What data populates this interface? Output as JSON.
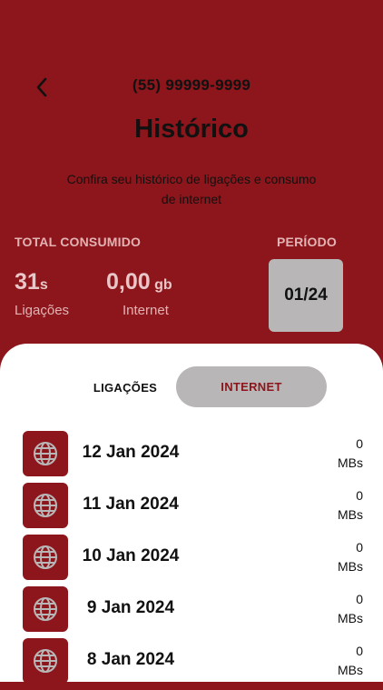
{
  "colors": {
    "primary": "#8c161b",
    "panel": "#ffffff",
    "chip": "#b8b6b6"
  },
  "header": {
    "back_icon": "chevron-left-icon",
    "phone": "(55) 99999-9999",
    "title": "Histórico",
    "subtitle": "Confira seu histórico de ligações e consumo de internet"
  },
  "summary": {
    "total_label": "TOTAL CONSUMIDO",
    "calls_value": "31",
    "calls_unit": "s",
    "calls_caption": "Ligações",
    "internet_value": "0,00",
    "internet_unit": "gb",
    "internet_caption": "Internet",
    "period_label": "PERÍODO",
    "period_value": "01/24"
  },
  "tabs": [
    {
      "label": "LIGAÇÕES",
      "active": false
    },
    {
      "label": "INTERNET",
      "active": true
    }
  ],
  "history": [
    {
      "icon": "globe-icon",
      "date": "12 Jan 2024",
      "amount": "0",
      "unit": "MBs"
    },
    {
      "icon": "globe-icon",
      "date": "11 Jan 2024",
      "amount": "0",
      "unit": "MBs"
    },
    {
      "icon": "globe-icon",
      "date": "10 Jan 2024",
      "amount": "0",
      "unit": "MBs"
    },
    {
      "icon": "globe-icon",
      "date": "9 Jan 2024",
      "amount": "0",
      "unit": "MBs"
    },
    {
      "icon": "globe-icon",
      "date": "8 Jan 2024",
      "amount": "0",
      "unit": "MBs"
    }
  ]
}
